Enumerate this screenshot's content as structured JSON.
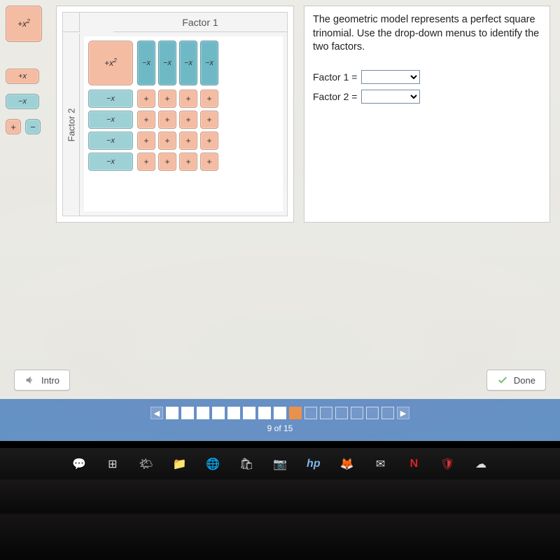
{
  "palette": {
    "x2": "+x",
    "x2_sup": "2",
    "plus_x": "+x",
    "minus_x": "−x",
    "plus": "+",
    "minus": "−"
  },
  "model": {
    "factor1": "Factor 1",
    "factor2": "Factor 2",
    "x2": "+x",
    "x2_sup": "2",
    "neg_x": "−x",
    "plus": "+"
  },
  "question": {
    "text": "The geometric model represents a perfect square trinomial. Use the drop-down menus to identify the two factors.",
    "f1_label": "Factor 1 =",
    "f2_label": "Factor 2 ="
  },
  "buttons": {
    "intro": "Intro",
    "done": "Done"
  },
  "progress": {
    "count_text": "9 of 15",
    "current": 9,
    "total": 15
  },
  "taskbar": {
    "icons": [
      "notify",
      "taskview",
      "weather",
      "files",
      "edge",
      "store",
      "camera",
      "hp",
      "firefox",
      "mail",
      "netflix",
      "mcafee",
      "onedrive"
    ]
  }
}
